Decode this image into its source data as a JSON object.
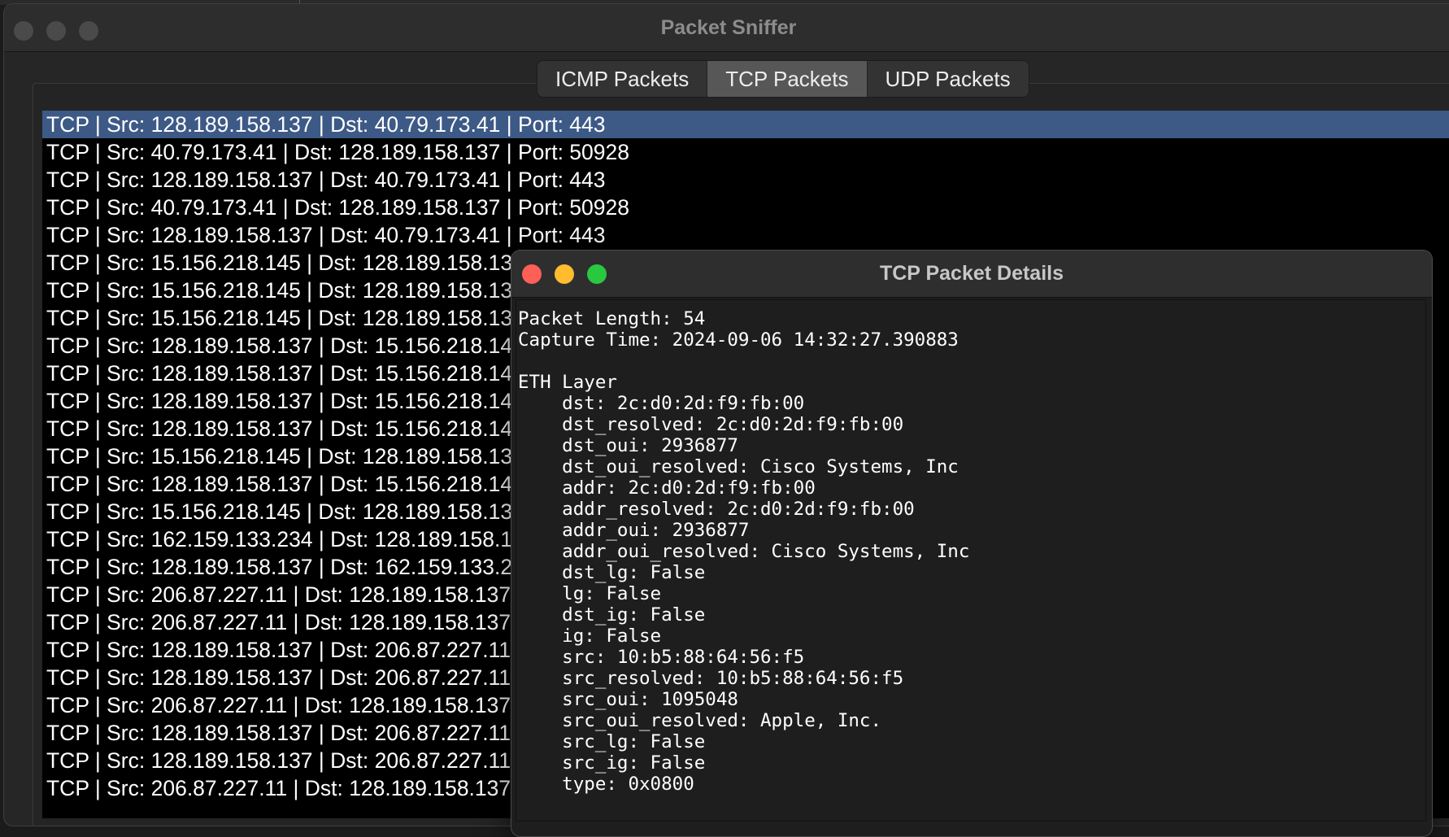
{
  "main_window": {
    "title": "Packet Sniffer",
    "tabs": [
      {
        "label": "ICMP Packets",
        "active": false
      },
      {
        "label": "TCP Packets",
        "active": true
      },
      {
        "label": "UDP Packets",
        "active": false
      }
    ],
    "packets": [
      "TCP | Src: 128.189.158.137 | Dst: 40.79.173.41 | Port: 443",
      "TCP | Src: 40.79.173.41 | Dst: 128.189.158.137 | Port: 50928",
      "TCP | Src: 128.189.158.137 | Dst: 40.79.173.41 | Port: 443",
      "TCP | Src: 40.79.173.41 | Dst: 128.189.158.137 | Port: 50928",
      "TCP | Src: 128.189.158.137 | Dst: 40.79.173.41 | Port: 443",
      "TCP | Src: 15.156.218.145 | Dst: 128.189.158.13",
      "TCP | Src: 15.156.218.145 | Dst: 128.189.158.13",
      "TCP | Src: 15.156.218.145 | Dst: 128.189.158.13",
      "TCP | Src: 128.189.158.137 | Dst: 15.156.218.14",
      "TCP | Src: 128.189.158.137 | Dst: 15.156.218.14",
      "TCP | Src: 128.189.158.137 | Dst: 15.156.218.14",
      "TCP | Src: 128.189.158.137 | Dst: 15.156.218.14",
      "TCP | Src: 15.156.218.145 | Dst: 128.189.158.13",
      "TCP | Src: 128.189.158.137 | Dst: 15.156.218.14",
      "TCP | Src: 15.156.218.145 | Dst: 128.189.158.13",
      "TCP | Src: 162.159.133.234 | Dst: 128.189.158.1",
      "TCP | Src: 128.189.158.137 | Dst: 162.159.133.2",
      "TCP | Src: 206.87.227.11 | Dst: 128.189.158.137",
      "TCP | Src: 206.87.227.11 | Dst: 128.189.158.137",
      "TCP | Src: 128.189.158.137 | Dst: 206.87.227.11",
      "TCP | Src: 128.189.158.137 | Dst: 206.87.227.11",
      "TCP | Src: 206.87.227.11 | Dst: 128.189.158.137",
      "TCP | Src: 128.189.158.137 | Dst: 206.87.227.11",
      "TCP | Src: 128.189.158.137 | Dst: 206.87.227.11",
      "TCP | Src: 206.87.227.11 | Dst: 128.189.158.137"
    ],
    "selected_index": 0
  },
  "details_window": {
    "title": "TCP Packet Details",
    "lines": [
      "Packet Length: 54",
      "Capture Time: 2024-09-06 14:32:27.390883",
      "",
      "ETH Layer",
      "    dst: 2c:d0:2d:f9:fb:00",
      "    dst_resolved: 2c:d0:2d:f9:fb:00",
      "    dst_oui: 2936877",
      "    dst_oui_resolved: Cisco Systems, Inc",
      "    addr: 2c:d0:2d:f9:fb:00",
      "    addr_resolved: 2c:d0:2d:f9:fb:00",
      "    addr_oui: 2936877",
      "    addr_oui_resolved: Cisco Systems, Inc",
      "    dst_lg: False",
      "    lg: False",
      "    dst_ig: False",
      "    ig: False",
      "    src: 10:b5:88:64:56:f5",
      "    src_resolved: 10:b5:88:64:56:f5",
      "    src_oui: 1095048",
      "    src_oui_resolved: Apple, Inc.",
      "    src_lg: False",
      "    src_ig: False",
      "    type: 0x0800"
    ]
  },
  "colors": {
    "selection": "#3d5a86",
    "close": "#fe5f57",
    "minimize": "#febc2e",
    "zoom": "#28c840"
  }
}
